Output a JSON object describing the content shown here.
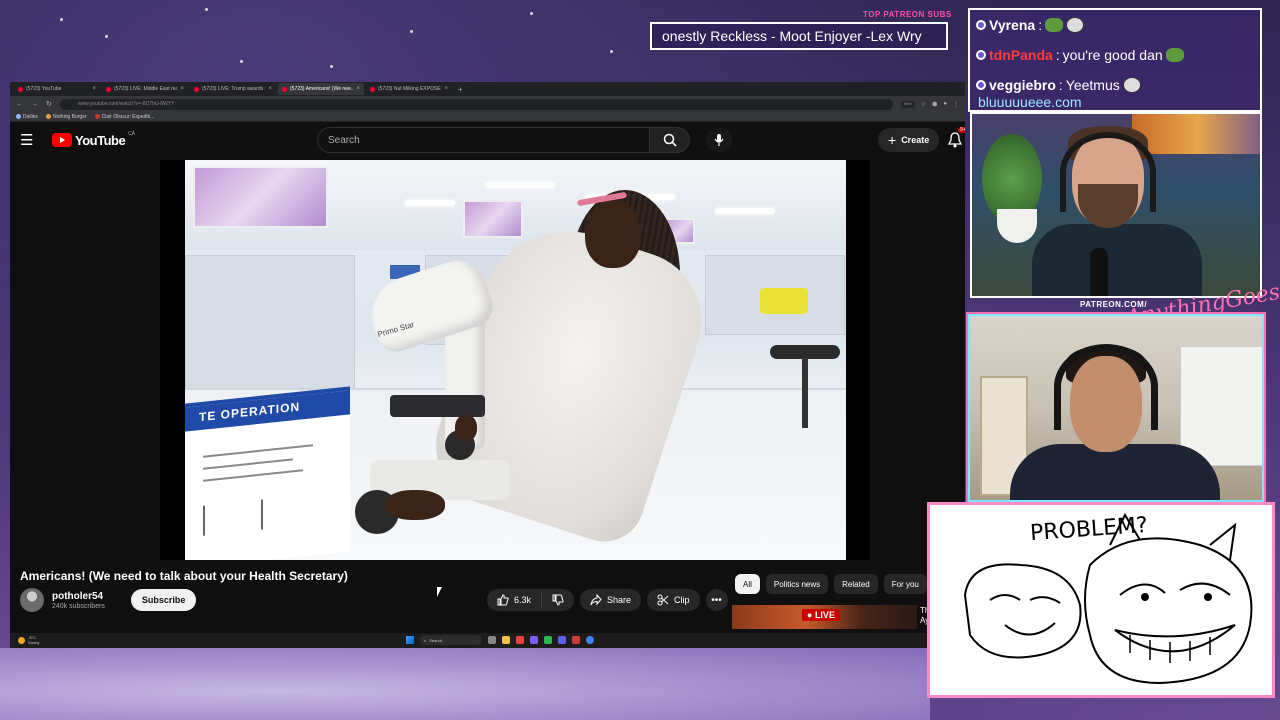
{
  "browser": {
    "tabs": [
      {
        "label": "(5723) YouTube",
        "active": false
      },
      {
        "label": "(5723) LIVE: Middle East real-ti...",
        "active": false
      },
      {
        "label": "(5723) LIVE: Trump awards Mar...",
        "active": false
      },
      {
        "label": "(5723) Americans! (We nee...",
        "active": true
      },
      {
        "label": "(5723) Nut Milking EXPOSED -",
        "active": false
      }
    ],
    "url": "www.youtube.com/watch?v=-8O7hU-8WYY",
    "zoom": "90%",
    "bookmarks": [
      "Dailies",
      "Nothing Burger",
      "Clair Obscur: Expediti..."
    ]
  },
  "youtube": {
    "logo_text": "YouTube",
    "region": "CA",
    "search_placeholder": "Search",
    "create_label": "Create",
    "notif_count": "9+",
    "video": {
      "microscope_brand": "Primo Star",
      "sign_text": "TE OPERATION",
      "title": "Americans! (We need to talk about your Health Secretary)"
    },
    "channel": {
      "name": "potholer54",
      "subscribers": "240k subscribers",
      "subscribe_label": "Subscribe"
    },
    "actions": {
      "likes": "6.3k",
      "share": "Share",
      "clip": "Clip"
    },
    "chips": [
      "All",
      "Politics news",
      "Related",
      "For you"
    ],
    "live_label": "LIVE",
    "sidebar_partial_title": [
      "Th",
      "Ay"
    ]
  },
  "taskbar": {
    "temperature": "-8°C",
    "condition": "Sunny",
    "search_label": "Search"
  },
  "overlay": {
    "patreon_label": "TOP PATREON SUBS",
    "ticker_text": "onestly Reckless - Moot Enjoyer -Lex Wry",
    "chat": [
      {
        "name": "Vyrena",
        "message": "",
        "name_color": "#ffffff"
      },
      {
        "name": "tdnPanda",
        "message": "you're good dan",
        "name_color": "#ff3b3b"
      },
      {
        "name": "veggiebro",
        "message": "Yeetmus",
        "name_color": "#ffffff"
      }
    ],
    "chat_partial": "bluuuuueee.com",
    "patreon_url": "PATREON.COM/",
    "signature": "AnythingGoes",
    "drawing_text": "PROBLEM?"
  }
}
